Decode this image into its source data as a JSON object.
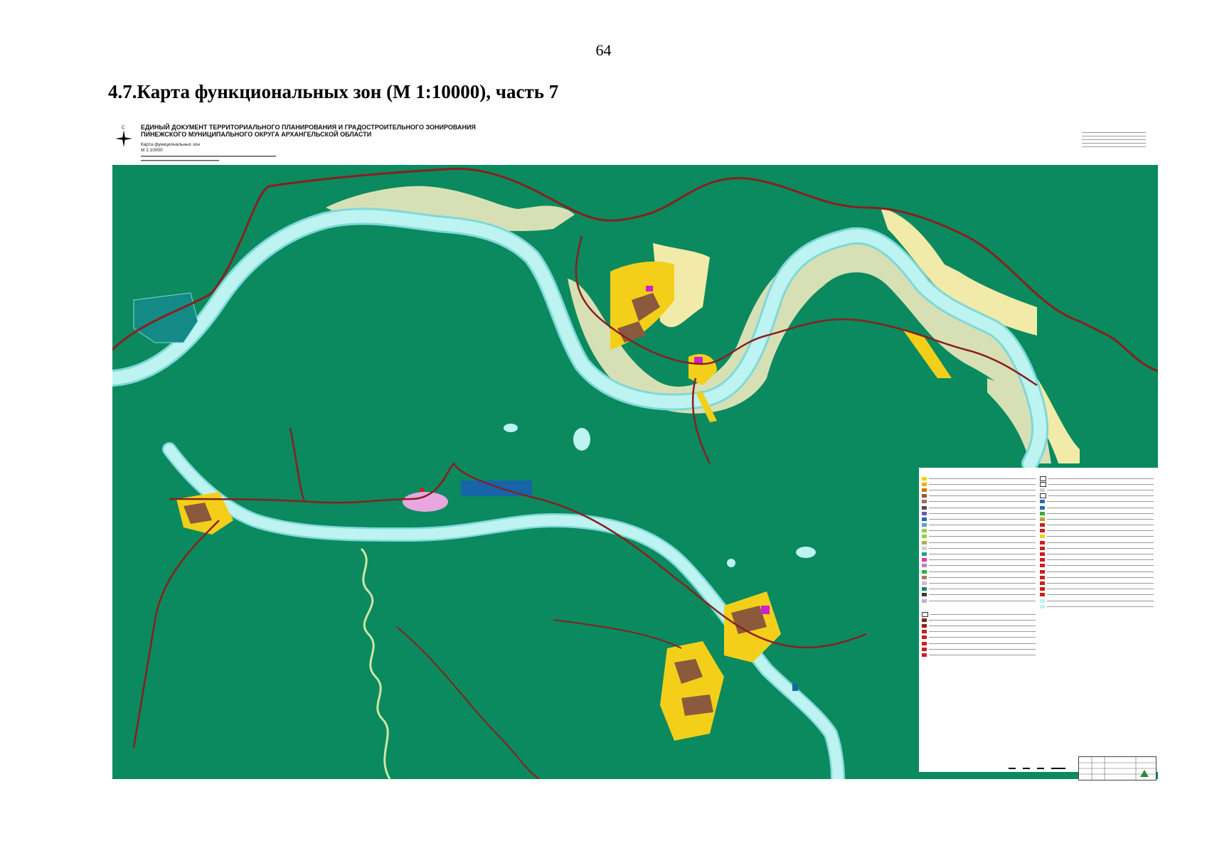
{
  "page_number": "64",
  "page_title": "4.7.Карта функциональных зон (М 1:10000), часть 7",
  "map_header": {
    "title_line1": "ЕДИНЫЙ ДОКУМЕНТ ТЕРРИТОРИАЛЬНОГО ПЛАНИРОВАНИЯ И ГРАДОСТРОИТЕЛЬНОГО ЗОНИРОВАНИЯ",
    "title_line2": "ПИНЕЖСКОГО МУНИЦИПАЛЬНОГО ОКРУГА  АРХАНГЕЛЬСКОЙ ОБЛАСТИ",
    "map_name": "Карта функциональных зон",
    "scale": "М 1:10000"
  },
  "compass_label": "С",
  "colors": {
    "forest": "#0a8a5e",
    "river": "#bdf3f0",
    "river_edge": "#7fd8d8",
    "floodplain": "#d7e0b5",
    "sand": "#f1eaa8",
    "residential": "#f3cf1a",
    "building": "#8b5a3c",
    "road": "#8a1f1f",
    "lake_dark": "#1565a8",
    "swamp": "#148a86",
    "garden": "#e8a7e0"
  }
}
